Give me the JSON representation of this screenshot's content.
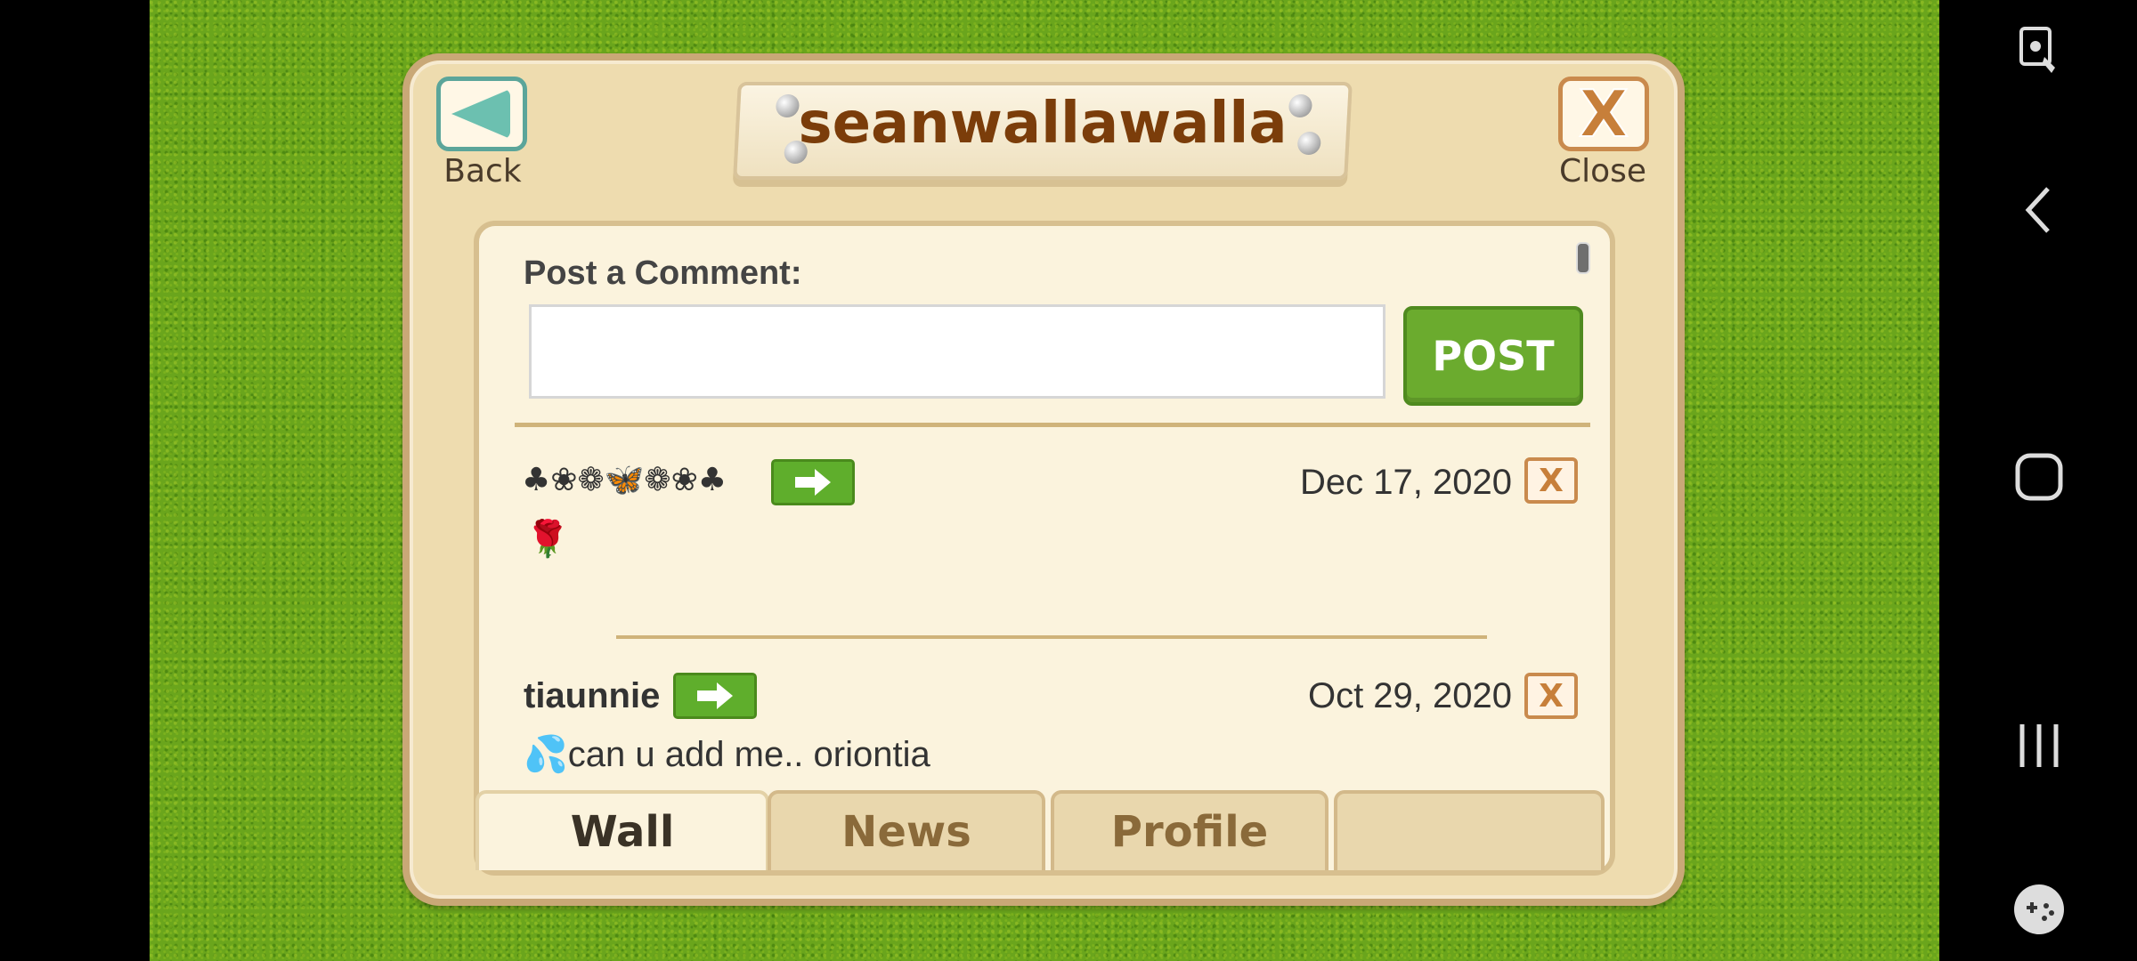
{
  "header": {
    "title": "seanwallawalla",
    "back_label": "Back",
    "close_label": "Close"
  },
  "comment_form": {
    "label": "Post a Comment:",
    "input_value": "",
    "post_label": "POST"
  },
  "comments": [
    {
      "author": "♣❀❁🦋❁❀♣",
      "date": "Dec 17, 2020",
      "message": "🌹"
    },
    {
      "author": "tiaunnie",
      "date": "Oct 29, 2020",
      "message": "💦can u add me.. oriontia"
    }
  ],
  "tabs": [
    {
      "label": "Wall",
      "active": true
    },
    {
      "label": "News",
      "active": false
    },
    {
      "label": "Profile",
      "active": false
    },
    {
      "label": "",
      "active": false
    }
  ],
  "colors": {
    "accent_green": "#6bab2e",
    "title_brown": "#7b3d0a",
    "grass": "#6aa51c"
  },
  "system_bar": {
    "icons": [
      "accessibility-icon",
      "back-icon",
      "home-icon",
      "recents-icon",
      "game-launcher-icon"
    ]
  }
}
